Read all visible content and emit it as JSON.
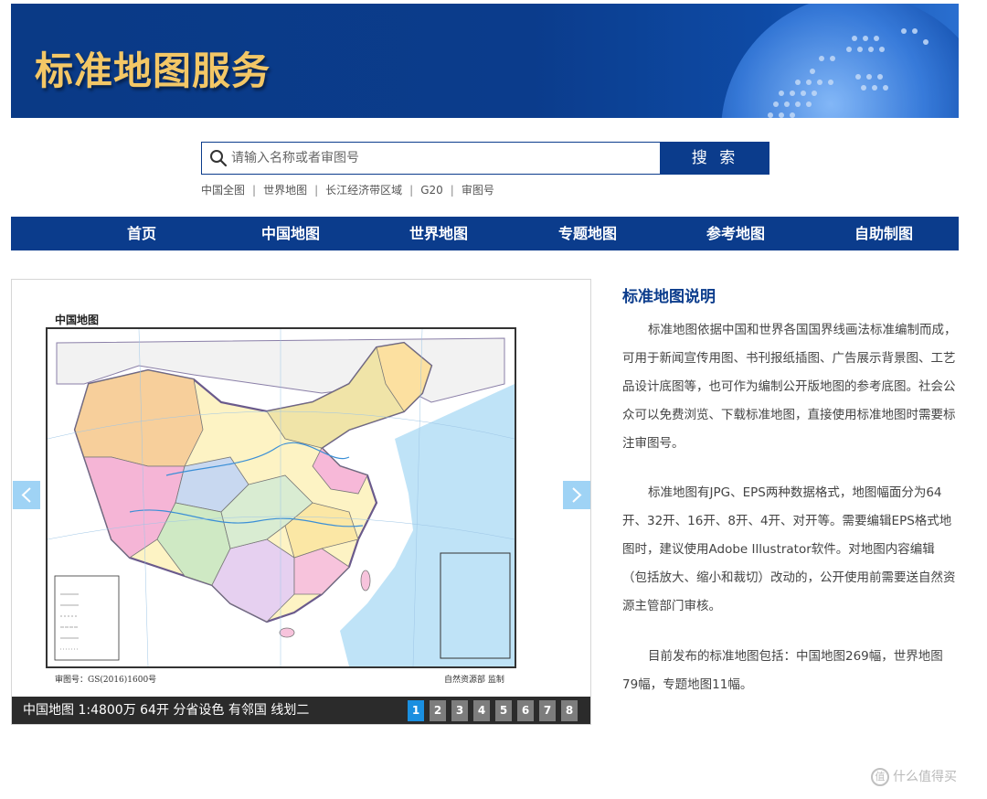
{
  "banner": {
    "title": "标准地图服务"
  },
  "search": {
    "placeholder": "请输入名称或者审图号",
    "button_label": "搜 索"
  },
  "quick_links": [
    "中国全图",
    "世界地图",
    "长江经济带区域",
    "G20",
    "审图号"
  ],
  "nav": {
    "items": [
      "首页",
      "中国地图",
      "世界地图",
      "专题地图",
      "参考地图",
      "自助制图"
    ]
  },
  "slider": {
    "map_title": "中国地图",
    "approval_no": "审图号：GS(2016)1600号",
    "supervisor": "自然资源部 监制",
    "caption": "中国地图 1:4800万 64开 分省设色 有邻国 线划二",
    "pages": [
      "1",
      "2",
      "3",
      "4",
      "5",
      "6",
      "7",
      "8"
    ],
    "active_page": 1
  },
  "description": {
    "title": "标准地图说明",
    "paragraphs": [
      "标准地图依据中国和世界各国国界线画法标准编制而成，可用于新闻宣传用图、书刊报纸插图、广告展示背景图、工艺品设计底图等，也可作为编制公开版地图的参考底图。社会公众可以免费浏览、下载标准地图，直接使用标准地图时需要标注审图号。",
      "标准地图有JPG、EPS两种数据格式，地图幅面分为64开、32开、16开、8开、4开、对开等。需要编辑EPS格式地图时，建议使用Adobe Illustrator软件。对地图内容编辑（包括放大、缩小和裁切）改动的，公开使用前需要送自然资源主管部门审核。",
      "目前发布的标准地图包括：中国地图269幅，世界地图79幅，专题地图11幅。"
    ]
  },
  "watermark": {
    "text": "什么值得买"
  },
  "colors": {
    "primary": "#0b3c8c",
    "accent": "#1a8fe0",
    "banner_title": "#f3c766",
    "caption_bg": "#2b2b2b"
  }
}
